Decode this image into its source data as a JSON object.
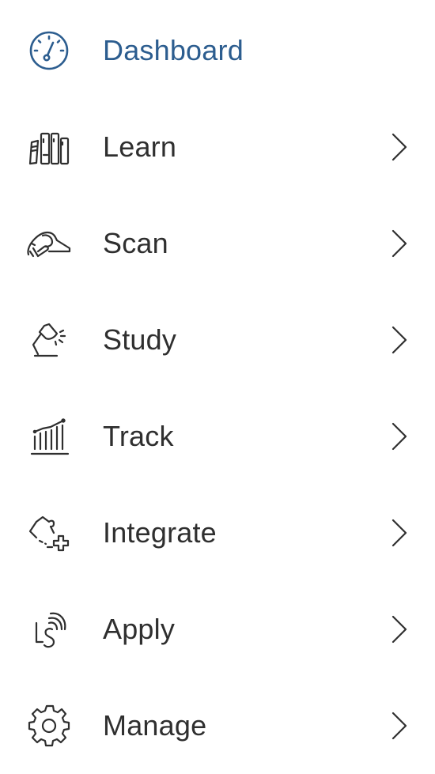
{
  "colors": {
    "active": "#2c5d8f",
    "text": "#2f2f2f",
    "background": "#ffffff"
  },
  "nav": {
    "items": [
      {
        "label": "Dashboard",
        "icon": "dashboard-gauge-icon",
        "active": true,
        "has_submenu": false
      },
      {
        "label": "Learn",
        "icon": "books-icon",
        "active": false,
        "has_submenu": true
      },
      {
        "label": "Scan",
        "icon": "hand-scanner-icon",
        "active": false,
        "has_submenu": true
      },
      {
        "label": "Study",
        "icon": "desk-lamp-icon",
        "active": false,
        "has_submenu": true
      },
      {
        "label": "Track",
        "icon": "bar-chart-trend-icon",
        "active": false,
        "has_submenu": true
      },
      {
        "label": "Integrate",
        "icon": "puzzle-plus-icon",
        "active": false,
        "has_submenu": true
      },
      {
        "label": "Apply",
        "icon": "ls-signal-icon",
        "active": false,
        "has_submenu": true
      },
      {
        "label": "Manage",
        "icon": "gear-icon",
        "active": false,
        "has_submenu": true
      }
    ]
  }
}
